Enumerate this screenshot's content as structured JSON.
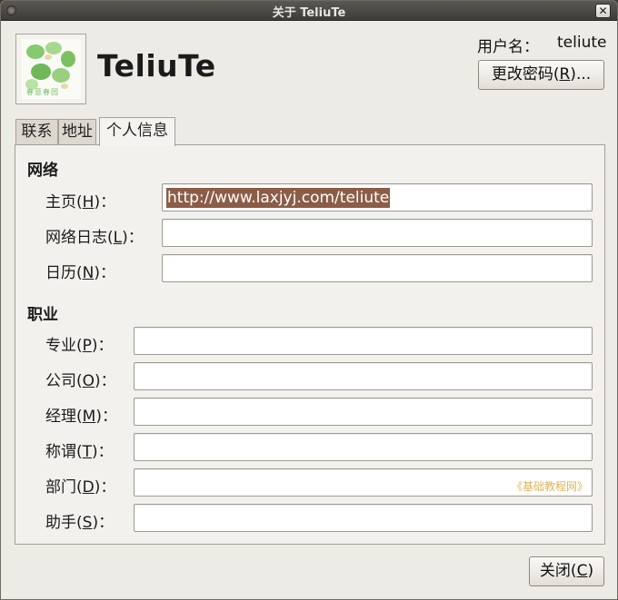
{
  "window": {
    "title": "关于 TeliuTe",
    "close_glyph": "✕"
  },
  "profile": {
    "full_name": "TeliuTe",
    "avatar_stamp": "春意春园",
    "username_label": "用户名：",
    "username_value": "teliute",
    "change_password_button": {
      "text": "更改密码",
      "mnemonic": "R",
      "suffix": "..."
    }
  },
  "tabs": [
    {
      "label": "联系",
      "active": false
    },
    {
      "label": "地址",
      "active": false
    },
    {
      "label": "个人信息",
      "active": true
    }
  ],
  "sections": {
    "network": {
      "heading": "网络",
      "fields": [
        {
          "label": "主页",
          "mnemonic": "H",
          "value": "http://www.laxjyj.com/teliute",
          "selected": true
        },
        {
          "label": "网络日志",
          "mnemonic": "L",
          "value": ""
        },
        {
          "label": "日历",
          "mnemonic": "N",
          "value": ""
        }
      ]
    },
    "job": {
      "heading": "职业",
      "fields": [
        {
          "label": "专业",
          "mnemonic": "P",
          "value": ""
        },
        {
          "label": "公司",
          "mnemonic": "O",
          "value": ""
        },
        {
          "label": "经理",
          "mnemonic": "M",
          "value": ""
        },
        {
          "label": "称谓",
          "mnemonic": "T",
          "value": ""
        },
        {
          "label": "部门",
          "mnemonic": "D",
          "value": "",
          "watermark": "《基础教程网》"
        },
        {
          "label": "助手",
          "mnemonic": "S",
          "value": ""
        }
      ]
    }
  },
  "footer": {
    "close_button": {
      "text": "关闭",
      "mnemonic": "C"
    }
  },
  "colors": {
    "selection": "#8b5d46",
    "window_bg": "#edebe6",
    "titlebar": "#3d3c38"
  }
}
